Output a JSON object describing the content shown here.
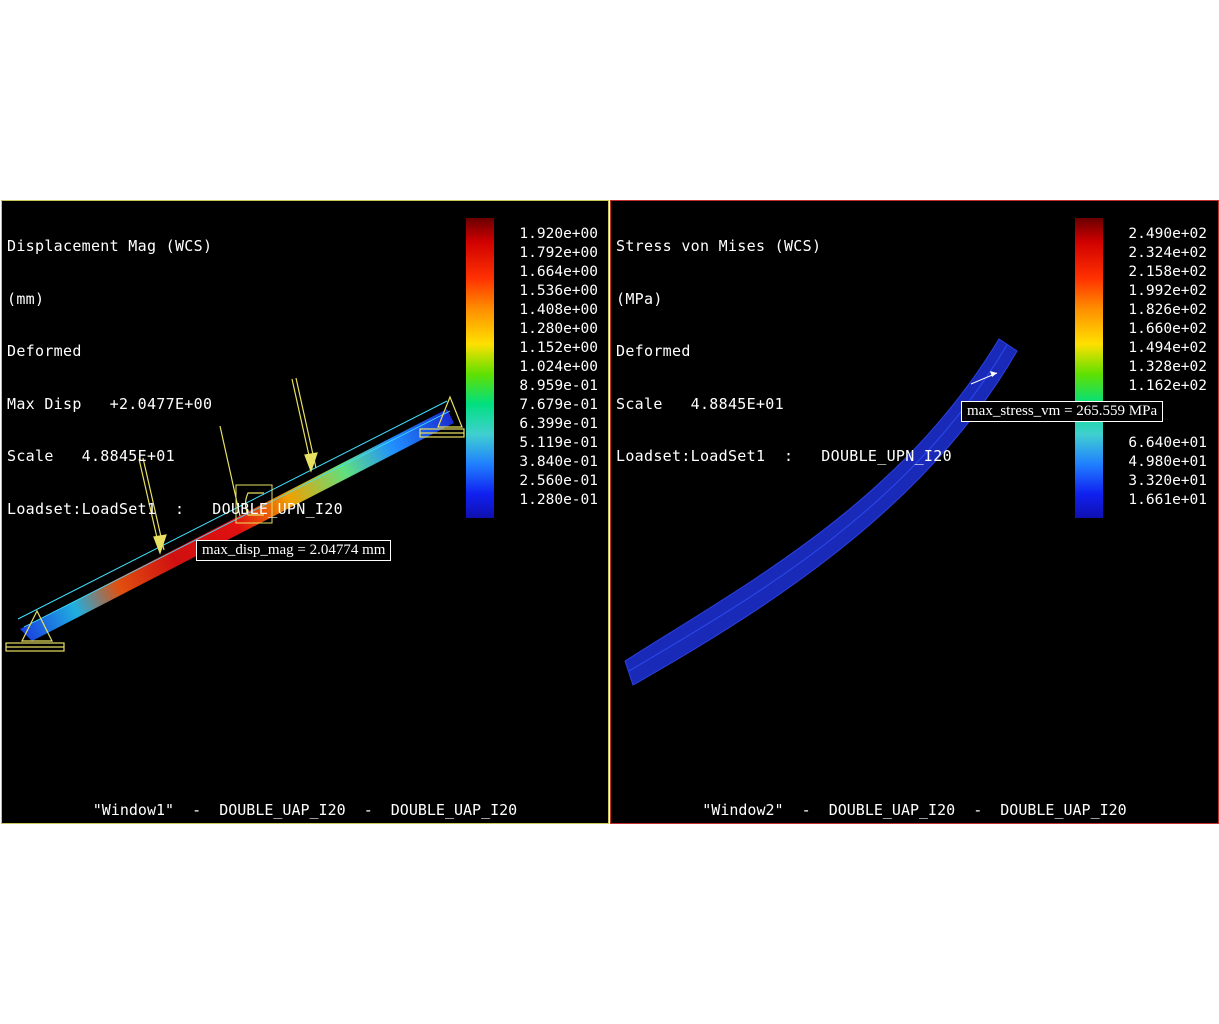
{
  "window1": {
    "header": [
      "Displacement Mag (WCS)",
      "(mm)",
      "Deformed",
      "Max Disp   +2.0477E+00",
      "Scale   4.8845E+01",
      "Loadset:LoadSet1  :   DOUBLE_UPN_I20"
    ],
    "legend": [
      "1.920e+00",
      "1.792e+00",
      "1.664e+00",
      "1.536e+00",
      "1.408e+00",
      "1.280e+00",
      "1.152e+00",
      "1.024e+00",
      "8.959e-01",
      "7.679e-01",
      "6.399e-01",
      "5.119e-01",
      "3.840e-01",
      "2.560e-01",
      "1.280e-01"
    ],
    "callout": "max_disp_mag = 2.04774  mm",
    "footer": "\"Window1\"  -  DOUBLE_UAP_I20  -  DOUBLE_UAP_I20",
    "border_color": "#c8c85a"
  },
  "window2": {
    "header": [
      "Stress von Mises (WCS)",
      "(MPa)",
      "Deformed",
      "Scale   4.8845E+01",
      "Loadset:LoadSet1  :   DOUBLE_UPN_I20"
    ],
    "legend": [
      "2.490e+02",
      "2.324e+02",
      "2.158e+02",
      "1.992e+02",
      "1.826e+02",
      "1.660e+02",
      "1.494e+02",
      "1.328e+02",
      "1.162e+02",
      "",
      "",
      "6.640e+01",
      "4.980e+01",
      "3.320e+01",
      "1.661e+01"
    ],
    "callout": "max_stress_vm = 265.559  MPa",
    "footer": "\"Window2\"  -  DOUBLE_UAP_I20  -  DOUBLE_UAP_I20",
    "border_color": "#c03030"
  },
  "colors": {
    "background": "#000000",
    "load_arrow": "#e8e060",
    "beam_low": "#1a2ad0",
    "beam_high": "#e01010"
  }
}
